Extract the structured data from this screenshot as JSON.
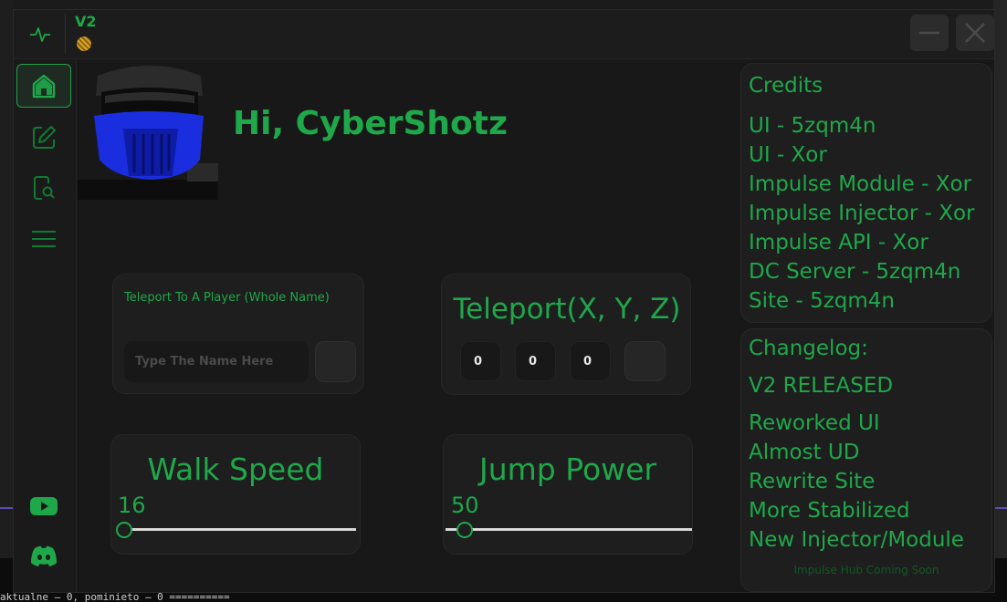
{
  "window": {
    "title": "V2",
    "colors": {
      "accent": "#1fa84a",
      "background": "#181818",
      "card": "#1e1e1e"
    }
  },
  "sidebar": {
    "items": [
      {
        "name": "home",
        "icon": "home-icon",
        "active": true
      },
      {
        "name": "editor",
        "icon": "edit-icon",
        "active": false
      },
      {
        "name": "search",
        "icon": "search-document-icon",
        "active": false
      },
      {
        "name": "menu",
        "icon": "menu-icon",
        "active": false
      }
    ],
    "bottom_icons": [
      "youtube-icon",
      "discord-icon"
    ]
  },
  "home": {
    "greeting": "Hi, CyberShotz"
  },
  "teleport_player": {
    "label": "Teleport To A Player (Whole Name)",
    "placeholder": "Type The Name Here",
    "value": ""
  },
  "teleport_xyz": {
    "title": "Teleport(X, Y, Z)",
    "x": "0",
    "y": "0",
    "z": "0"
  },
  "walk_speed": {
    "title": "Walk Speed",
    "value": "16",
    "level": 0.0
  },
  "jump_power": {
    "title": "Jump Power",
    "value": "50",
    "level": 0.0
  },
  "credits": {
    "title": "Credits",
    "items": [
      "UI - 5zqm4n",
      "UI - Xor",
      "Impulse Module - Xor",
      "Impulse Injector - Xor",
      "Impulse API - Xor",
      "DC Server - 5zqm4n",
      "Site - 5zqm4n"
    ]
  },
  "changelog": {
    "title": "Changelog:",
    "headline": "V2 RELEASED",
    "items": [
      "Reworked UI",
      "Almost UD",
      "Rewrite Site",
      "More Stabilized",
      "New Injector/Module"
    ],
    "footer": "Impulse Hub Coming Soon"
  },
  "background": {
    "terminal_line": "aktualne – 0, pominieto – 0 =========="
  }
}
